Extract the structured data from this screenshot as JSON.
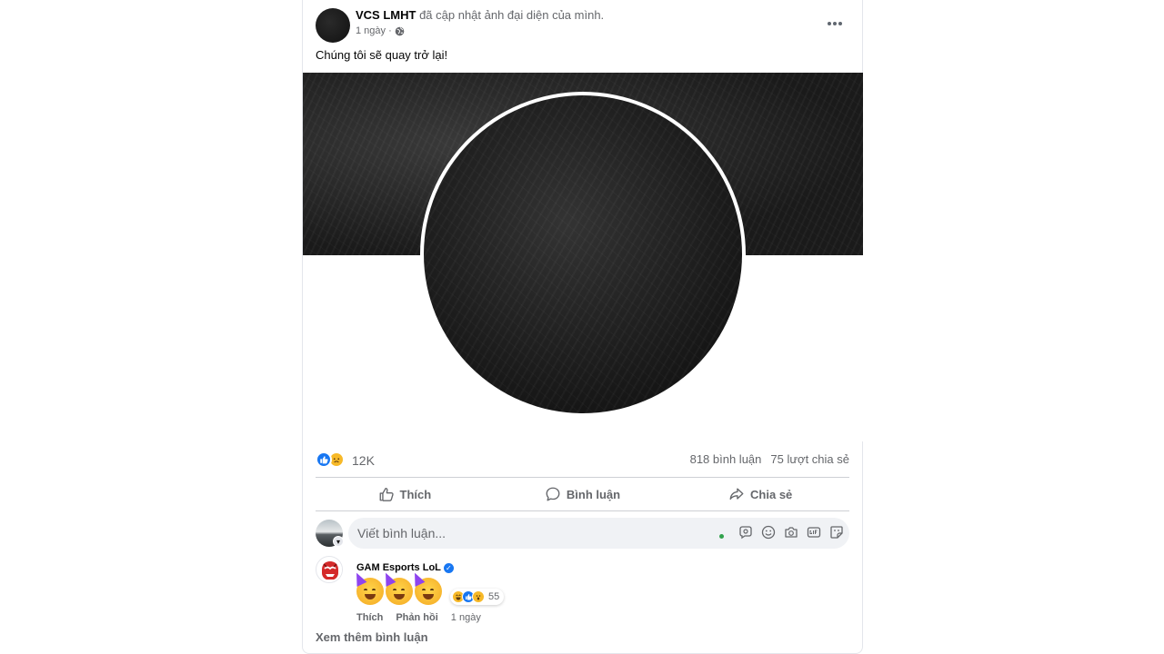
{
  "post": {
    "page_name": "VCS LMHT",
    "action_text": " đã cập nhật ảnh đại diện của mình.",
    "time": "1 ngày ·",
    "caption": "Chúng tôi sẽ quay trở lại!"
  },
  "stats": {
    "reaction_count": "12K",
    "comments": "818 bình luận",
    "shares": "75 lượt chia sẻ"
  },
  "actions": {
    "like": "Thích",
    "comment": "Bình luận",
    "share": "Chia sẻ"
  },
  "composer": {
    "placeholder": "Viết bình luận..."
  },
  "comment": {
    "author": "GAM Esports LoL",
    "reaction_count": "55",
    "like_label": "Thích",
    "reply_label": "Phản hồi",
    "time": "1 ngày"
  },
  "more_comments": "Xem thêm bình luận"
}
